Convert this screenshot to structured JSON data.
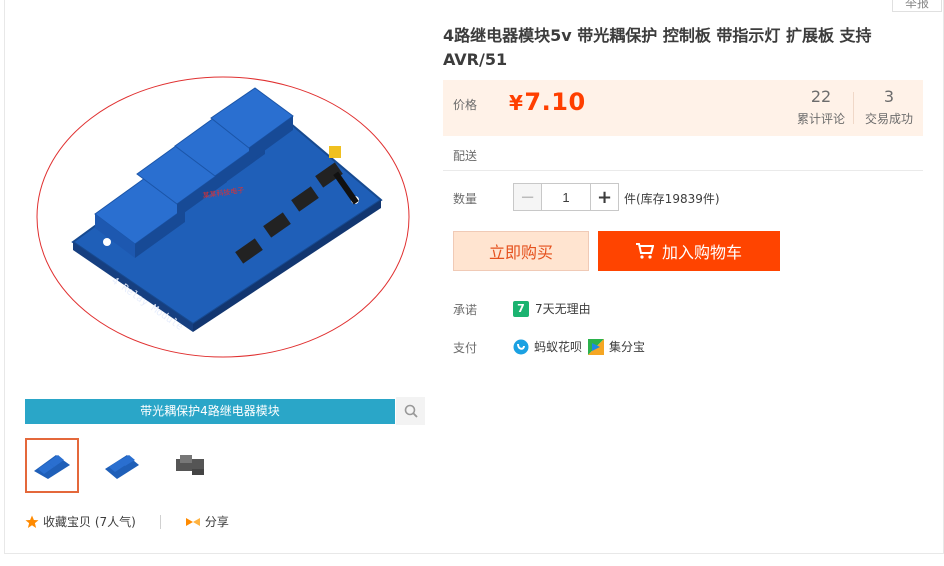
{
  "header": {
    "report_label": "举报"
  },
  "product": {
    "title": "4路继电器模块5v 带光耦保护 控制板 带指示灯 扩展板 支持AVR/51",
    "image_caption": "带光耦保护4路继电器模块",
    "board_label": "4 Relay Module",
    "overlay_text": "某某科技电子"
  },
  "price_panel": {
    "price_label": "价格",
    "currency": "¥",
    "price": "7.10",
    "reviews_count": "22",
    "reviews_label": "累计评论",
    "deals_count": "3",
    "deals_label": "交易成功"
  },
  "delivery": {
    "label": "配送"
  },
  "quantity": {
    "label": "数量",
    "value": "1",
    "minus": "−",
    "plus": "+",
    "stock_text": "件(库存19839件)"
  },
  "actions": {
    "buy_now": "立即购买",
    "add_to_cart": "加入购物车"
  },
  "promise": {
    "label": "承诺",
    "badge": "7",
    "text": "7天无理由"
  },
  "payment": {
    "label": "支付",
    "methods": [
      "蚂蚁花呗",
      "集分宝"
    ]
  },
  "social": {
    "favorite": "收藏宝贝 (7人气)",
    "share": "分享"
  },
  "colors": {
    "accent": "#ff4400",
    "price": "#ff3f00",
    "caption_bg": "#2aa6c8",
    "board": "#1f5fb8",
    "relay": "#2a6fd0"
  },
  "icons": {
    "search": "search-icon",
    "star": "star-icon",
    "share": "share-icon",
    "cart": "cart-icon",
    "huabei": "huabei-icon",
    "jifenbao": "jifenbao-icon"
  }
}
